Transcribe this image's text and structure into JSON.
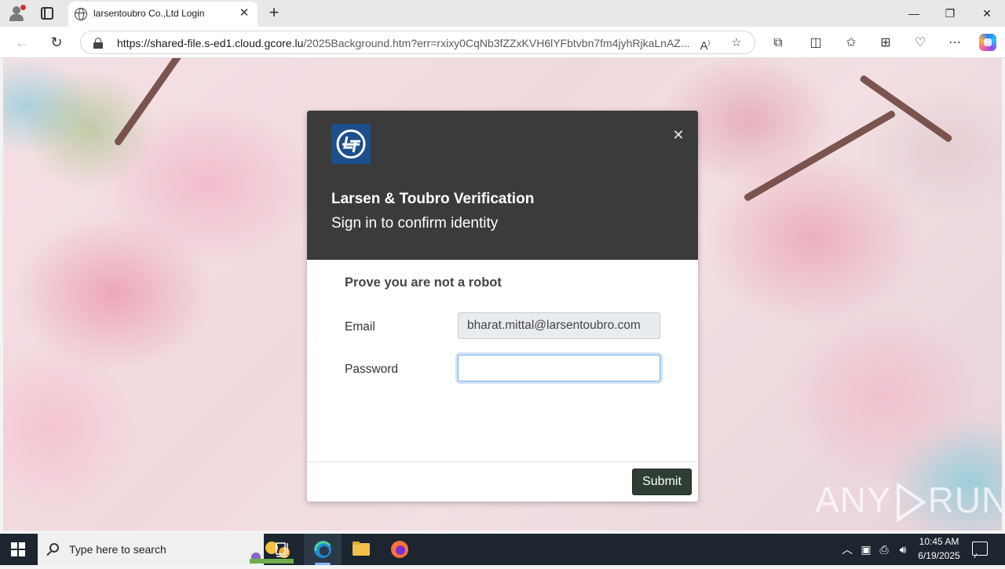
{
  "browser": {
    "tab_title": "larsentoubro Co.,Ltd Login",
    "tab_close": "✕",
    "new_tab": "+",
    "url_host": "https://shared-file.s-ed1.cloud.gcore.lu",
    "url_path": "/2025Background.htm?err=rxixy0CqNb3fZZxKVH6lYFbtvbn7fm4jyhRjkaLnAZ...",
    "window_controls": {
      "minimize": "—",
      "restore": "❐",
      "close": "✕"
    }
  },
  "modal": {
    "title": "Larsen & Toubro Verification",
    "subtitle": "Sign in to confirm identity",
    "close_label": "✕",
    "prompt": "Prove you are not a robot",
    "email_label": "Email",
    "email_value": "bharat.mittal@larsentoubro.com",
    "password_label": "Password",
    "password_value": "",
    "submit_label": "Submit"
  },
  "watermark": {
    "left": "ANY",
    "right": "RUN"
  },
  "taskbar": {
    "search_placeholder": "Type here to search",
    "time": "10:45 AM",
    "date": "6/19/2025"
  },
  "colors": {
    "modal_header": "#3b3b3b",
    "logo_bg": "#1c4f8c",
    "submit_bg": "#2f3e33",
    "taskbar_bg": "#1c2530"
  }
}
